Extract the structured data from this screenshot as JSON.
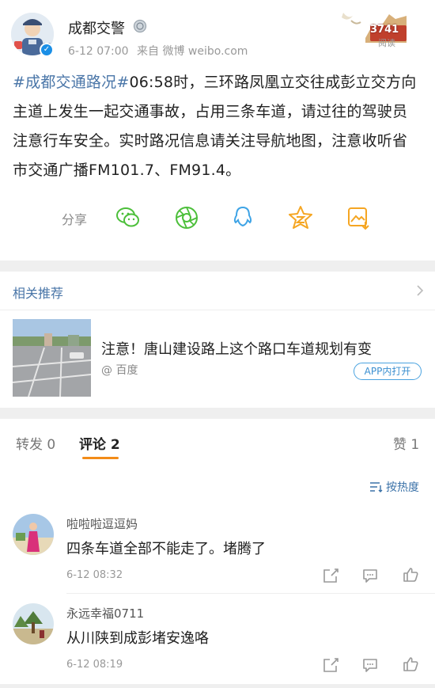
{
  "post": {
    "author": "成都交警",
    "time": "6-12 07:00",
    "source": "来自 微博 weibo.com",
    "read_count": "3741",
    "read_label": "阅读",
    "topic": "#成都交通路况#",
    "text": "06:58时，三环路凤凰立交往成彭立交方向主道上发生一起交通事故，占用三条车道，请过往的驾驶员注意行车安全。实时路况信息请关注导航地图，注意收听省市交通广播FM101.7、FM91.4。",
    "share_label": "分享",
    "share_icons": [
      "wechat-icon",
      "moments-icon",
      "qq-icon",
      "qzone-icon",
      "save-image-icon"
    ]
  },
  "recommend": {
    "title": "相关推荐",
    "headline": "注意！唐山建设路上这个路口车道规划有变",
    "source": "@ 百度",
    "open_label": "APP内打开"
  },
  "comments": {
    "tabs": {
      "repost": "转发 0",
      "comment": "评论 2",
      "like": "赞 1"
    },
    "sort_label": "按热度",
    "items": [
      {
        "user": "啦啦啦逗逗妈",
        "text": "四条车道全部不能走了。堵腾了",
        "time": "6-12 08:32"
      },
      {
        "user": "永远幸福0711",
        "text": "从川陕到成彭堵安逸咯",
        "time": "6-12 08:19"
      }
    ]
  },
  "colors": {
    "link": "#4a76a8",
    "accent": "#f28c18",
    "share": "#4cbf3a",
    "star": "#f5a623"
  }
}
